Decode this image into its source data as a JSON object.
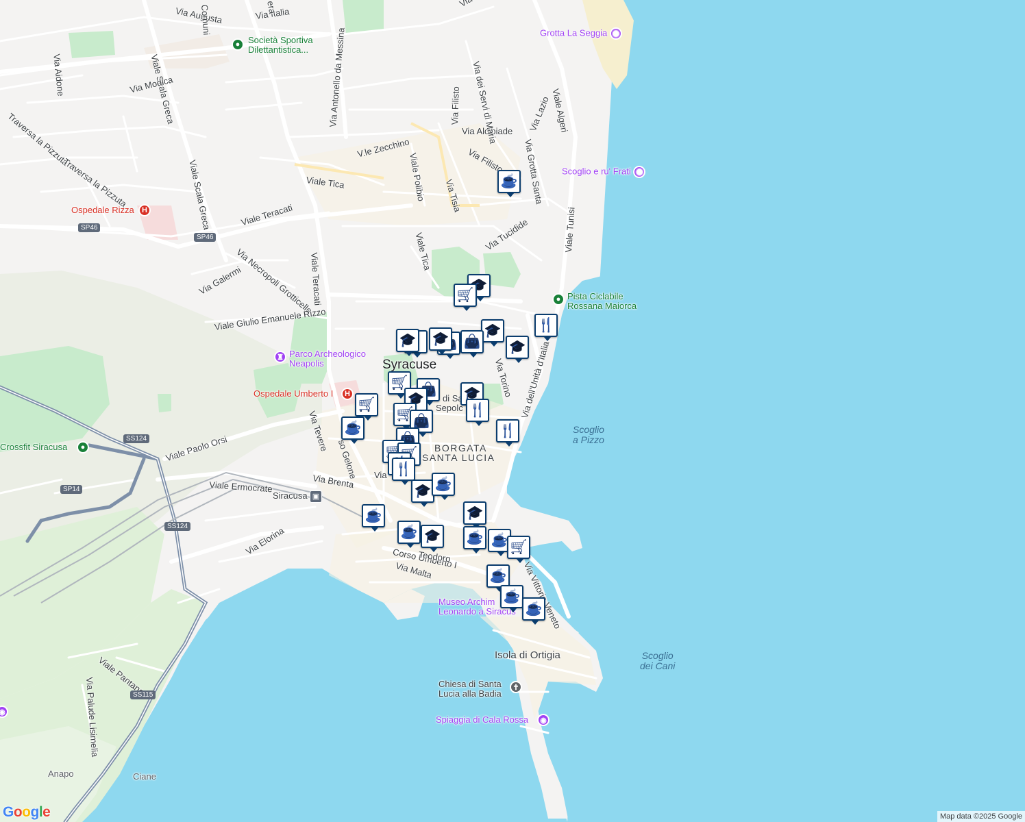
{
  "roads": [
    {
      "name": "via-italia",
      "label": "Via Italia"
    },
    {
      "name": "via-augusta",
      "label": "Via Augusta"
    },
    {
      "name": "via-antonello-da-messina",
      "label": "Via Antonello da Messina"
    },
    {
      "name": "viale-scala-greca",
      "label": "Viale Scala Greca"
    },
    {
      "name": "via-aidone",
      "label": "Via Aidone"
    },
    {
      "name": "via-modica",
      "label": "Via Modica"
    },
    {
      "name": "traversa-la-pizzuta-1",
      "label": "Traversa la Pizzuta"
    },
    {
      "name": "traversa-la-pizzuta-2",
      "label": "Traversa la Pizzuta"
    },
    {
      "name": "viale-scala-greca-2",
      "label": "Viale Scala Greca"
    },
    {
      "name": "viale-teracati",
      "label": "Viale Teracati"
    },
    {
      "name": "viale-teracati-2",
      "label": "Viale Teracati"
    },
    {
      "name": "viale-tica",
      "label": "Viale Tica"
    },
    {
      "name": "viale-tica-2",
      "label": "Viale Tica"
    },
    {
      "name": "v-le-zecchino",
      "label": "V.le Zecchino"
    },
    {
      "name": "viale-polibio",
      "label": "Viale Polibio"
    },
    {
      "name": "via-tisia",
      "label": "Via Tisia"
    },
    {
      "name": "via-filisto",
      "label": "Via Filisto"
    },
    {
      "name": "via-filisto-2",
      "label": "Via Filisto"
    },
    {
      "name": "via-alcibiade",
      "label": "Via Alcibiade"
    },
    {
      "name": "via-dei-servi-di-maria",
      "label": "Via dei Servi di Maria"
    },
    {
      "name": "via-grotta-santa",
      "label": "Via Grotta Santa"
    },
    {
      "name": "via-lazio",
      "label": "Via Lazio"
    },
    {
      "name": "viale-algeri",
      "label": "Viale Algeri"
    },
    {
      "name": "viale-tunisi",
      "label": "Viale Tunisi"
    },
    {
      "name": "via-tucidide",
      "label": "Via Tucidide"
    },
    {
      "name": "via-necropoli-grotticelle",
      "label": "Via Necropoli Grotticelle"
    },
    {
      "name": "via-galermi",
      "label": "Via Galermi"
    },
    {
      "name": "viale-giulio-emanuele-rizzo",
      "label": "Viale Giulio Emanuele Rizzo"
    },
    {
      "name": "viale-paolo-orsi",
      "label": "Viale Paolo Orsi"
    },
    {
      "name": "via-tevere",
      "label": "Via Tevere"
    },
    {
      "name": "corso-gelone",
      "label": "so Gelone"
    },
    {
      "name": "via-brenta",
      "label": "Via Brenta"
    },
    {
      "name": "viale-ermocrate",
      "label": "Viale Ermocrate"
    },
    {
      "name": "via-elorina",
      "label": "Via Elorina"
    },
    {
      "name": "via-torino",
      "label": "Via Torino"
    },
    {
      "name": "via-dell-unita-d-italia",
      "label": "Via dell'Unità d'Italia"
    },
    {
      "name": "corso-umberto-i",
      "label": "Corso Umberto I"
    },
    {
      "name": "via-malta",
      "label": "Via Malta"
    },
    {
      "name": "via-teodoro",
      "label": "Teodoro"
    },
    {
      "name": "via-vittorio-veneto",
      "label": "Via Vittorio Veneto"
    },
    {
      "name": "viale-pantanelli",
      "label": "Viale Pantanelli"
    },
    {
      "name": "via-palude-lisimelia",
      "label": "Via Palude Lisimelia"
    },
    {
      "name": "via-comuni",
      "label": "Comuni"
    },
    {
      "name": "via-era",
      "label": "era"
    },
    {
      "name": "via-via-short",
      "label": "Via"
    },
    {
      "name": "via-top-right",
      "label": "Via"
    }
  ],
  "shields": [
    {
      "name": "sp46-shield-1",
      "label": "SP46"
    },
    {
      "name": "sp46-shield-2",
      "label": "SP46"
    },
    {
      "name": "ss124-shield-1",
      "label": "SS124"
    },
    {
      "name": "ss124-shield-2",
      "label": "SS124"
    },
    {
      "name": "sp14-shield",
      "label": "SP14"
    },
    {
      "name": "ss115-shield",
      "label": "SS115"
    }
  ],
  "places": {
    "city": "Syracuse",
    "district_1": "BORGATA",
    "district_2": "SANTA LUCIA",
    "island": "Isola di Ortigia",
    "santo_sepolcro_1": "di San",
    "santo_sepolcro_2": "Sepolc",
    "anapo": "Anapo",
    "ciane": "Ciane",
    "station": "Siracusa"
  },
  "water_labels": {
    "scoglio_a_pizzo_1": "Scoglio",
    "scoglio_a_pizzo_2": "a Pizzo",
    "scoglio_dei_cani_1": "Scoglio",
    "scoglio_dei_cani_2": "dei Cani"
  },
  "pois": [
    {
      "name": "poi-grotta-la-seggia",
      "label": "Grotta La Seggia",
      "kind": "camera",
      "color": "#a142f4"
    },
    {
      "name": "poi-scoglio-e-ru-frati",
      "label": "Scoglio e ru' Frati",
      "kind": "camera",
      "color": "#a142f4"
    },
    {
      "name": "poi-societa-sportiva",
      "label": "Società Sportiva",
      "label2": "Dilettantistica...",
      "kind": "sport",
      "color": "#188038"
    },
    {
      "name": "poi-ospedale-rizza",
      "label": "Ospedale Rizza",
      "kind": "hospital",
      "color": "#d93025"
    },
    {
      "name": "poi-pista-ciclabile",
      "label": "Pista Ciclabile",
      "label2": "Rossana Maiorca",
      "kind": "park",
      "color": "#188038"
    },
    {
      "name": "poi-parco-archeologico",
      "label": "Parco Archeologico",
      "label2": "Neapolis",
      "kind": "monument",
      "color": "#a142f4"
    },
    {
      "name": "poi-ospedale-umberto",
      "label": "Ospedale Umberto I",
      "kind": "hospital",
      "color": "#d93025"
    },
    {
      "name": "poi-crossfit-siracusa",
      "label": "Crossfit Siracusa",
      "kind": "sport",
      "color": "#188038"
    },
    {
      "name": "poi-museo-archimede",
      "label": "Museo Archim",
      "label2": "Leonardo a Siracus",
      "kind": "museum",
      "color": "#a142f4"
    },
    {
      "name": "poi-chiesa-santa-lucia",
      "label": "Chiesa di Santa",
      "label2": "Lucia alla Badia",
      "kind": "church",
      "color": "#5f6368"
    },
    {
      "name": "poi-spiaggia-cala-rossa",
      "label": "Spiaggia di Cala Rossa",
      "kind": "camera",
      "color": "#a142f4"
    }
  ],
  "markers": [
    {
      "name": "marker-cafe",
      "type": "cafe"
    },
    {
      "name": "marker-school",
      "type": "school"
    },
    {
      "name": "marker-grocery",
      "type": "grocery"
    },
    {
      "name": "marker-restaurant",
      "type": "restaurant"
    },
    {
      "name": "marker-school",
      "type": "school"
    },
    {
      "name": "marker-school",
      "type": "school"
    },
    {
      "name": "marker-restaurant",
      "type": "restaurant"
    },
    {
      "name": "marker-school",
      "type": "school"
    },
    {
      "name": "marker-shopping",
      "type": "shopping"
    },
    {
      "name": "marker-shopping",
      "type": "shopping"
    },
    {
      "name": "marker-school",
      "type": "school"
    },
    {
      "name": "marker-school",
      "type": "school"
    },
    {
      "name": "marker-grocery",
      "type": "grocery"
    },
    {
      "name": "marker-shopping",
      "type": "shopping"
    },
    {
      "name": "marker-school",
      "type": "school"
    },
    {
      "name": "marker-restaurant",
      "type": "restaurant"
    },
    {
      "name": "marker-grocery",
      "type": "grocery"
    },
    {
      "name": "marker-cafe",
      "type": "cafe"
    },
    {
      "name": "marker-grocery",
      "type": "grocery"
    },
    {
      "name": "marker-shopping",
      "type": "shopping"
    },
    {
      "name": "marker-shopping",
      "type": "shopping"
    },
    {
      "name": "marker-restaurant",
      "type": "restaurant"
    },
    {
      "name": "marker-grocery",
      "type": "grocery"
    },
    {
      "name": "marker-grocery",
      "type": "grocery"
    },
    {
      "name": "marker-restaurant",
      "type": "restaurant"
    },
    {
      "name": "marker-restaurant",
      "type": "restaurant"
    },
    {
      "name": "marker-school",
      "type": "school"
    },
    {
      "name": "marker-cafe",
      "type": "cafe"
    },
    {
      "name": "marker-school",
      "type": "school"
    },
    {
      "name": "marker-cafe",
      "type": "cafe"
    },
    {
      "name": "marker-cafe",
      "type": "cafe"
    },
    {
      "name": "marker-school",
      "type": "school"
    },
    {
      "name": "marker-cafe",
      "type": "cafe"
    },
    {
      "name": "marker-cafe",
      "type": "cafe"
    },
    {
      "name": "marker-grocery",
      "type": "grocery"
    },
    {
      "name": "marker-cafe",
      "type": "cafe"
    },
    {
      "name": "marker-cafe",
      "type": "cafe"
    },
    {
      "name": "marker-cafe",
      "type": "cafe"
    }
  ],
  "icons": {
    "cafe": "coffee-cup-icon",
    "school": "graduation-cap-icon",
    "grocery": "shopping-cart-icon",
    "restaurant": "fork-knife-icon",
    "shopping": "shopping-bag-icon"
  },
  "colors": {
    "water": "#8ed8ef",
    "land": "#f4f3f2",
    "park": "#c8ebcc",
    "marker": "#0b3d6e",
    "road_major": "#ffffff",
    "highway": "#7d8fa8",
    "rail": "#b0b6bd",
    "beach": "#f6efcf"
  },
  "logo": "Google",
  "attribution": "Map data ©2025 Google"
}
